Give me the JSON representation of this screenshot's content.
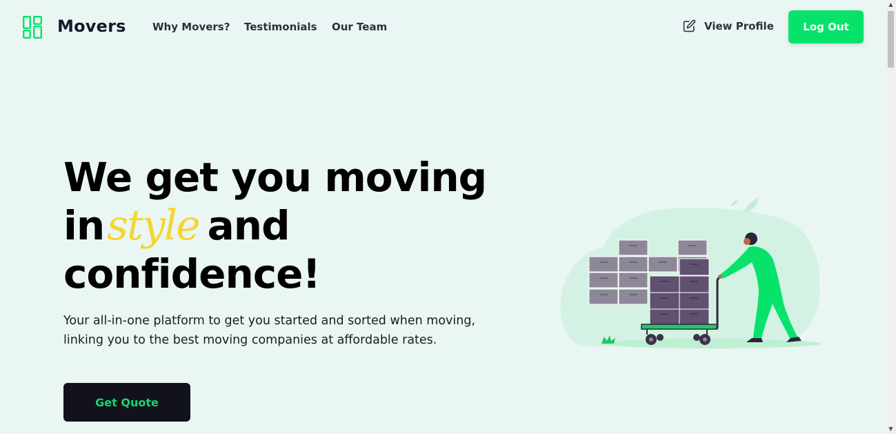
{
  "header": {
    "brand": "Movers",
    "nav": [
      "Why Movers?",
      "Testimonials",
      "Our Team"
    ],
    "view_profile_label": "View Profile",
    "logout_label": "Log Out"
  },
  "hero": {
    "headline_line1": "We get you moving",
    "headline_line2_start": "in",
    "headline_accent": "style",
    "headline_line2_end": "and",
    "headline_line3": "confidence!",
    "subtitle_line1": "Your all-in-one platform to get you started and sorted when moving,",
    "subtitle_line2": "linking you to the best moving companies at affordable rates.",
    "cta_label": "Get Quote"
  },
  "icons": {
    "logo": "layout-grid-icon",
    "profile": "edit-icon",
    "scroll_up": "arrow-up-icon",
    "scroll_down": "arrow-down-icon"
  },
  "colors": {
    "accent": "#07e26b",
    "background": "#eaf6f3",
    "headline_accent": "#f5d531",
    "cta_background": "#12121c",
    "cta_text": "#13d86a"
  }
}
